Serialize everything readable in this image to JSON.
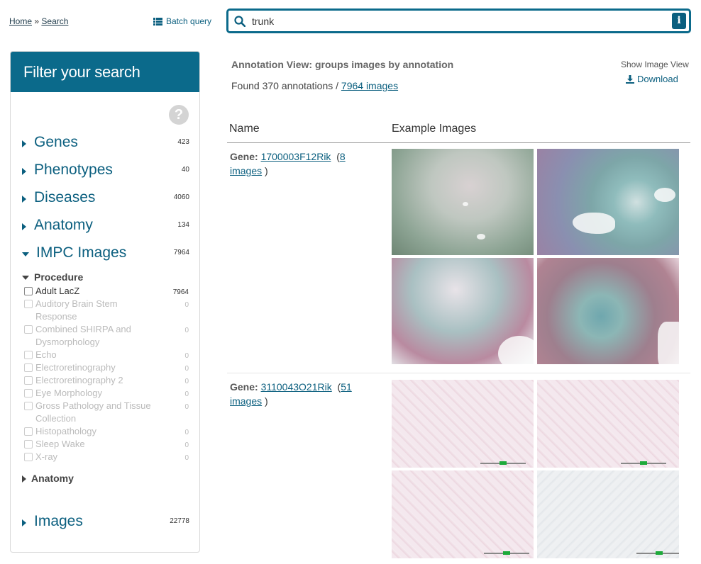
{
  "breadcrumb": {
    "home": "Home",
    "sep": "»",
    "current": "Search"
  },
  "batch_query": {
    "label": "Batch query",
    "icon": "list-icon"
  },
  "search": {
    "value": "trunk",
    "icon": "search-icon",
    "info": "i"
  },
  "sidebar": {
    "title": "Filter your search",
    "help": "?",
    "facets": [
      {
        "label": "Genes",
        "count": "423",
        "expanded": false
      },
      {
        "label": "Phenotypes",
        "count": "40",
        "expanded": false
      },
      {
        "label": "Diseases",
        "count": "4060",
        "expanded": false
      },
      {
        "label": "Anatomy",
        "count": "134",
        "expanded": false
      },
      {
        "label": "IMPC Images",
        "count": "7964",
        "expanded": true
      },
      {
        "label": "Images",
        "count": "22778",
        "expanded": false
      }
    ],
    "procedure_heading": "Procedure",
    "procedures": [
      {
        "label": "Adult LacZ",
        "count": "7964",
        "active": true
      },
      {
        "label": "Auditory Brain Stem Response",
        "count": "0",
        "active": false
      },
      {
        "label": "Combined SHIRPA and Dysmorphology",
        "count": "0",
        "active": false
      },
      {
        "label": "Echo",
        "count": "0",
        "active": false
      },
      {
        "label": "Electroretinography",
        "count": "0",
        "active": false
      },
      {
        "label": "Electroretinography 2",
        "count": "0",
        "active": false
      },
      {
        "label": "Eye Morphology",
        "count": "0",
        "active": false
      },
      {
        "label": "Gross Pathology and Tissue Collection",
        "count": "0",
        "active": false
      },
      {
        "label": "Histopathology",
        "count": "0",
        "active": false
      },
      {
        "label": "Sleep Wake",
        "count": "0",
        "active": false
      },
      {
        "label": "X-ray",
        "count": "0",
        "active": false
      }
    ],
    "anatomy_heading": "Anatomy"
  },
  "main": {
    "view_title": "Annotation View: groups images by annotation",
    "found_prefix": "Found 370 annotations /",
    "found_link": "7964 images",
    "show_image_view": "Show Image View",
    "download": "Download",
    "col_name": "Name",
    "col_images": "Example Images",
    "rows": [
      {
        "prefix": "Gene:",
        "gene": "1700003F12Rik",
        "images_link_a": "8",
        "images_link_b": "images",
        "close": ")"
      },
      {
        "prefix": "Gene:",
        "gene": "3110043O21Rik",
        "images_link_a": "51",
        "images_link_b": "images",
        "close": ")"
      }
    ]
  },
  "colors": {
    "brand": "#0b6a8b",
    "link": "#0b5f7f",
    "muted": "#bbbbbb"
  }
}
